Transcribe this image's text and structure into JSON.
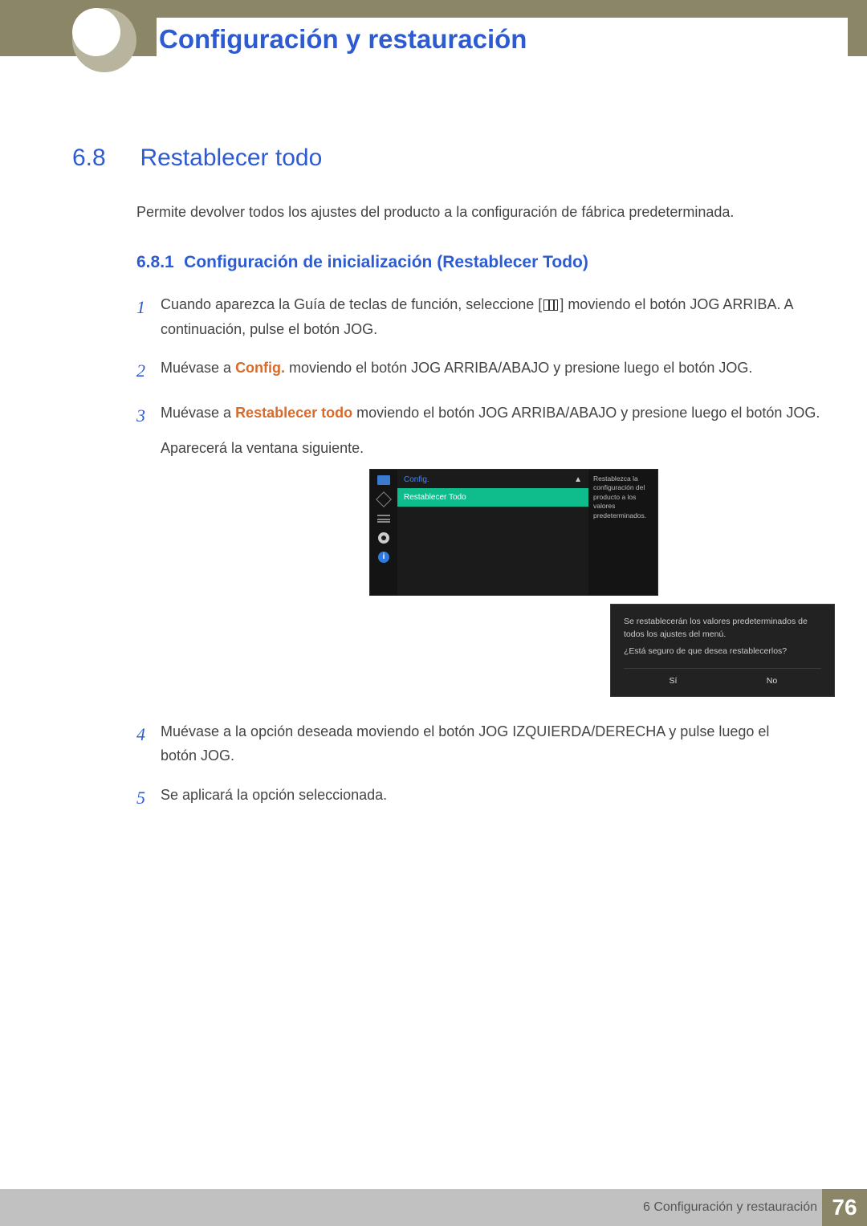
{
  "chapter": {
    "title": "Configuración y restauración"
  },
  "section": {
    "num": "6.8",
    "title": "Restablecer todo"
  },
  "intro": "Permite devolver todos los ajustes del producto a la configuración de fábrica predeterminada.",
  "subsection": {
    "num": "6.8.1",
    "title": "Configuración de inicialización (Restablecer Todo)"
  },
  "steps": {
    "s1a": "Cuando aparezca la Guía de teclas de función, seleccione [",
    "s1b": "] moviendo el botón JOG ARRIBA. A continuación, pulse el botón JOG.",
    "s2a": "Muévase a ",
    "s2kw": "Config.",
    "s2b": " moviendo el botón JOG ARRIBA/ABAJO y presione luego el botón JOG.",
    "s3a": "Muévase a ",
    "s3kw": "Restablecer todo",
    "s3b": " moviendo el botón JOG ARRIBA/ABAJO y presione luego el botón JOG.",
    "s3c": "Aparecerá la ventana siguiente.",
    "s4": "Muévase a la opción deseada moviendo el botón JOG IZQUIERDA/DERECHA y pulse luego el botón JOG.",
    "s5": "Se aplicará la opción seleccionada."
  },
  "nums": {
    "n1": "1",
    "n2": "2",
    "n3": "3",
    "n4": "4",
    "n5": "5"
  },
  "osd": {
    "header": "Config.",
    "arrow": "▲",
    "selected": "Restablecer Todo",
    "help": "Restablezca la configuración del producto a los valores predeterminados.",
    "info_glyph": "i"
  },
  "dialog": {
    "line1": "Se restablecerán los valores predeterminados de todos los ajustes del menú.",
    "line2": "¿Está seguro de que desea restablecerlos?",
    "yes": "Sí",
    "no": "No"
  },
  "footer": {
    "label": "6 Configuración y restauración",
    "page": "76"
  }
}
